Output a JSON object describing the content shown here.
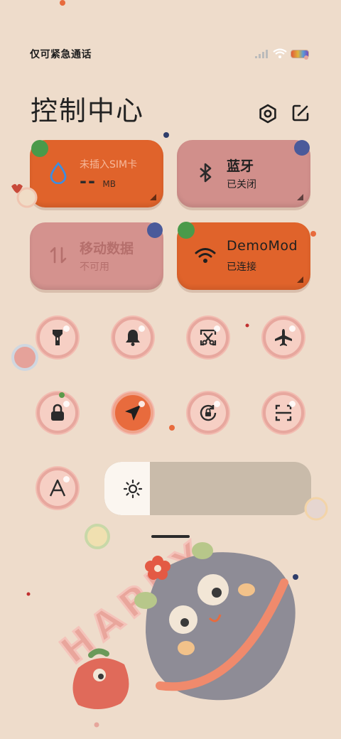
{
  "status_bar": {
    "carrier_text": "仅可紧急通话"
  },
  "header": {
    "title": "控制中心"
  },
  "tiles": {
    "sim": {
      "title": "未插入SIM卡",
      "value": "--",
      "unit": "MB"
    },
    "bluetooth": {
      "title": "蓝牙",
      "status": "已关闭"
    },
    "mobile_data": {
      "title": "移动数据",
      "status": "不可用"
    },
    "wifi": {
      "title": "DemoMod",
      "status": "已连接"
    }
  },
  "toggles": [
    {
      "name": "flashlight",
      "icon": "flashlight-icon",
      "active": false
    },
    {
      "name": "silent",
      "icon": "bell-icon",
      "active": false
    },
    {
      "name": "screenshot",
      "icon": "scissors-screenshot-icon",
      "active": false
    },
    {
      "name": "airplane",
      "icon": "airplane-icon",
      "active": false
    },
    {
      "name": "lock",
      "icon": "lock-icon",
      "active": false
    },
    {
      "name": "location",
      "icon": "location-arrow-icon",
      "active": true
    },
    {
      "name": "rotation-lock",
      "icon": "rotation-lock-icon",
      "active": false
    },
    {
      "name": "scanner",
      "icon": "scan-icon",
      "active": false
    },
    {
      "name": "auto-text",
      "icon": "letter-a-icon",
      "active": false
    }
  ],
  "brightness": {
    "level": 0.22
  },
  "colors": {
    "background": "#eedccb",
    "accent_orange": "#e0632b",
    "tile_pink": "#d18f8b"
  },
  "decoration": {
    "wallpaper_text": "HAPPY"
  }
}
